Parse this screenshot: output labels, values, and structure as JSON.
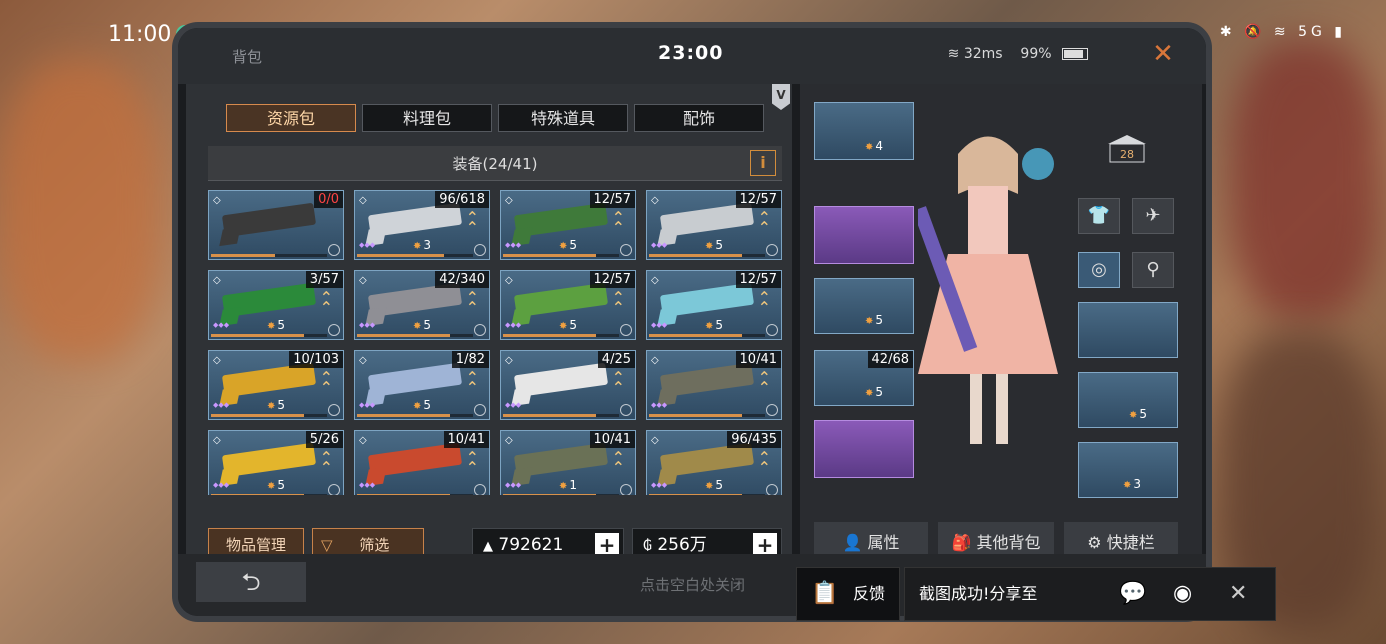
{
  "status_bar": {
    "time": "11:00",
    "icons": "✱ 🔕 ≋ 5G ▮"
  },
  "header": {
    "title": "背包",
    "game_time": "23:00",
    "ping": "32ms",
    "battery": "99%",
    "close": "✕"
  },
  "tabs": [
    {
      "label": "资源包",
      "active": true
    },
    {
      "label": "料理包",
      "active": false
    },
    {
      "label": "特殊道具",
      "active": false
    },
    {
      "label": "配饰",
      "active": false
    }
  ],
  "vip_badge": "V",
  "equipment": {
    "title": "装备(24/41)",
    "info_label": "i"
  },
  "slots": [
    {
      "count": "0/0",
      "red": true,
      "level": "",
      "color": "#3a3a3a",
      "progress": 0.55
    },
    {
      "count": "96/618",
      "level": "3",
      "color": "#cfd3d8",
      "progress": 0.75
    },
    {
      "count": "12/57",
      "level": "5",
      "color": "#3f7a3a",
      "progress": 0.8
    },
    {
      "count": "12/57",
      "level": "5",
      "color": "#c8ccd0",
      "progress": 0.8
    },
    {
      "count": "3/57",
      "level": "5",
      "color": "#2b8a3a",
      "progress": 0.8
    },
    {
      "count": "42/340",
      "level": "5",
      "color": "#8f8f95",
      "progress": 0.8
    },
    {
      "count": "12/57",
      "level": "5",
      "color": "#5ca040",
      "progress": 0.8
    },
    {
      "count": "12/57",
      "level": "5",
      "color": "#7cc8d8",
      "progress": 0.8
    },
    {
      "count": "10/103",
      "level": "5",
      "color": "#d9a428",
      "progress": 0.8
    },
    {
      "count": "1/82",
      "level": "5",
      "color": "#9fb4d6",
      "progress": 0.8
    },
    {
      "count": "4/25",
      "level": "",
      "color": "#e6e6e6",
      "progress": 0.8
    },
    {
      "count": "10/41",
      "level": "",
      "color": "#6e6e5e",
      "progress": 0.8
    },
    {
      "count": "5/26",
      "level": "5",
      "color": "#e3b52c",
      "progress": 0.8
    },
    {
      "count": "10/41",
      "level": "",
      "color": "#c94a2e",
      "progress": 0.8
    },
    {
      "count": "10/41",
      "level": "1",
      "color": "#6a7156",
      "progress": 0.8
    },
    {
      "count": "96/435",
      "level": "5",
      "color": "#a08a4a",
      "progress": 0.8
    }
  ],
  "actions": {
    "manage": "物品管理",
    "filter": "筛选",
    "filter_icon": "▽"
  },
  "currency": {
    "silver": "792621",
    "coins": "256万",
    "plus": "+"
  },
  "loadout": {
    "slots": [
      {
        "count": "",
        "level": "4"
      },
      {
        "count": "",
        "level": ""
      },
      {
        "count": "",
        "level": "5"
      },
      {
        "count": "42/68",
        "level": "5"
      },
      {
        "count": "",
        "level": ""
      }
    ],
    "right_slots": [
      {
        "level": ""
      },
      {
        "level": "5"
      },
      {
        "level": "3"
      }
    ],
    "level_badge": "28"
  },
  "bottom_buttons": {
    "attributes": "属性",
    "other_bags": "其他背包",
    "hotbar": "快捷栏"
  },
  "footer": {
    "back": "⮌",
    "hint": "点击空白处关闭"
  },
  "toast": {
    "feedback": "反馈",
    "message": "截图成功!分享至",
    "close": "✕"
  }
}
